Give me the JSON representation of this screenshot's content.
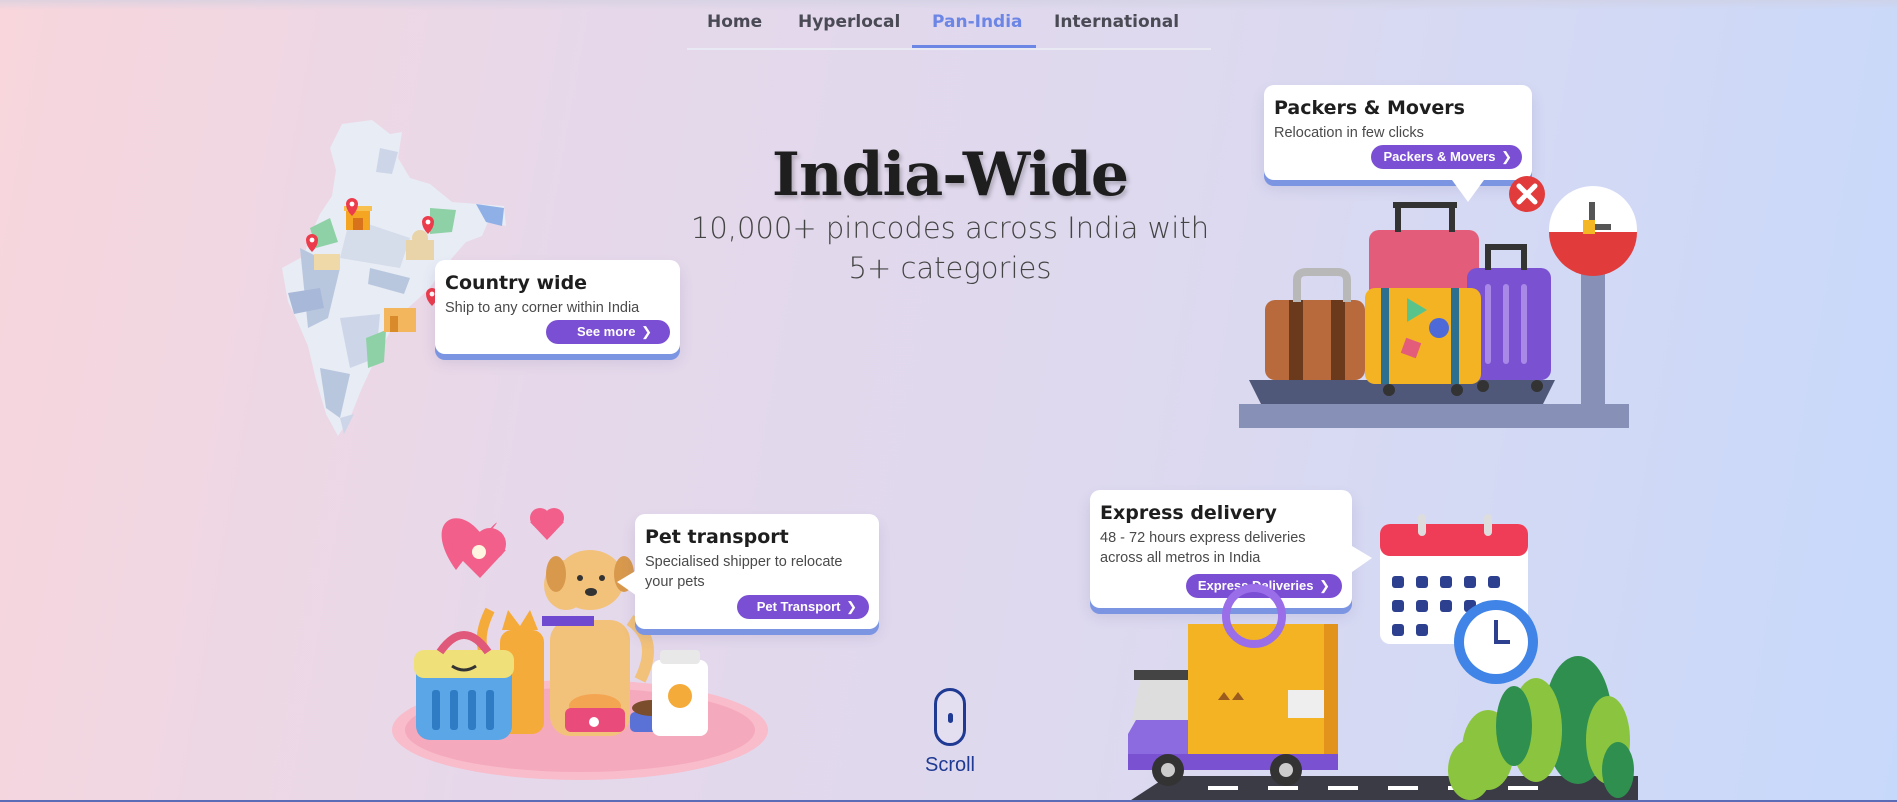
{
  "nav": {
    "items": [
      {
        "label": "Home",
        "active": false
      },
      {
        "label": "Hyperlocal",
        "active": false
      },
      {
        "label": "Pan-India",
        "active": true
      },
      {
        "label": "International",
        "active": false
      }
    ]
  },
  "hero": {
    "title": "India-Wide",
    "subtitle_line1": "10,000+ pincodes across India with",
    "subtitle_line2": "5+ categories"
  },
  "cards": {
    "country": {
      "title": "Country wide",
      "desc": "Ship to any corner within India",
      "button": "See more"
    },
    "packers": {
      "title": "Packers & Movers",
      "desc": "Relocation in few clicks",
      "button": "Packers & Movers"
    },
    "pet": {
      "title": "Pet transport",
      "desc_line1": "Specialised shipper to relocate",
      "desc_line2": "your pets",
      "button": "Pet Transport"
    },
    "express": {
      "title": "Express delivery",
      "desc_line1": "48 - 72 hours express deliveries",
      "desc_line2": "across all metros in India",
      "button": "Express Deliveries"
    }
  },
  "scroll": {
    "label": "Scroll"
  },
  "icons": {
    "chevron": "chevron-right-icon",
    "mouse": "mouse-scroll-icon"
  },
  "colors": {
    "accent": "#7b4fd3",
    "nav_active": "#6c86e6",
    "card_shadow": "#7b95e2",
    "scroll": "#1f3a93"
  }
}
